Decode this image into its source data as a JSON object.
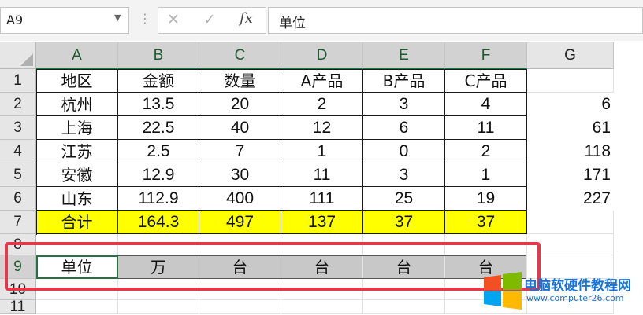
{
  "formula_bar": {
    "name_box": "A9",
    "fx_label": "fx",
    "formula": "单位"
  },
  "columns": [
    "A",
    "B",
    "C",
    "D",
    "E",
    "F",
    "G"
  ],
  "rows": [
    "1",
    "2",
    "3",
    "4",
    "5",
    "6",
    "7",
    "8",
    "9",
    "10",
    "11"
  ],
  "table": {
    "header": [
      "地区",
      "金额",
      "数量",
      "A产品",
      "B产品",
      "C产品"
    ],
    "body": [
      [
        "杭州",
        "13.5",
        "20",
        "2",
        "3",
        "4"
      ],
      [
        "上海",
        "22.5",
        "40",
        "12",
        "6",
        "11"
      ],
      [
        "江苏",
        "2.5",
        "7",
        "1",
        "0",
        "2"
      ],
      [
        "安徽",
        "12.9",
        "30",
        "11",
        "3",
        "1"
      ],
      [
        "山东",
        "112.9",
        "400",
        "111",
        "25",
        "19"
      ]
    ],
    "total": [
      "合计",
      "164.3",
      "497",
      "137",
      "37",
      "37"
    ]
  },
  "column_g": [
    "6",
    "61",
    "118",
    "171",
    "227"
  ],
  "units_row": [
    "单位",
    "万",
    "台",
    "台",
    "台",
    "台"
  ],
  "colors": {
    "total_fill": "#ffff00",
    "units_fill": "#c8c8c8",
    "highlight_border": "#e4394a",
    "selection": "#217346"
  },
  "watermark": {
    "title": "电脑软硬件教程网",
    "url": "www.computer26.com"
  }
}
